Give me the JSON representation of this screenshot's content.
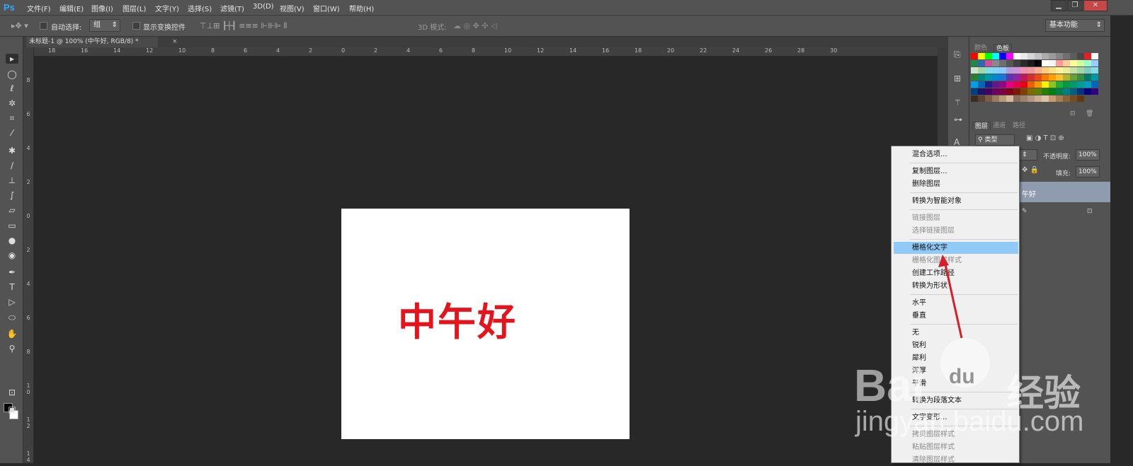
{
  "app": {
    "logo": "Ps",
    "menu": [
      "文件(F)",
      "编辑(E)",
      "图像(I)",
      "图层(L)",
      "文字(Y)",
      "选择(S)",
      "滤镜(T)",
      "3D(D)",
      "视图(V)",
      "窗口(W)",
      "帮助(H)"
    ],
    "window_buttons": [
      "▁",
      "❐",
      "✕"
    ]
  },
  "options": {
    "auto_select": "自动选择:",
    "group_value": "组",
    "show_transform": "显示变换控件",
    "mode3d": "3D 模式:",
    "workspace": "基本功能"
  },
  "document": {
    "tab_title": "未标题-1 @ 100% (中午好, RGB/8) *",
    "close": "×",
    "canvas_text": "中午好"
  },
  "rulers": {
    "h": [
      "18",
      "16",
      "14",
      "12",
      "10",
      "8",
      "6",
      "4",
      "2",
      "0",
      "2",
      "4",
      "6",
      "8",
      "10",
      "12",
      "14",
      "16",
      "18",
      "20",
      "22",
      "24",
      "26",
      "28",
      "30"
    ],
    "v": [
      "8",
      "6",
      "4",
      "2",
      "0",
      "2",
      "4",
      "6",
      "8",
      "1\n0",
      "1\n2",
      "1\n4"
    ]
  },
  "panels": {
    "color_tabs": [
      "颜色",
      "色板"
    ],
    "layers_tabs": [
      "图层",
      "通道",
      "路径"
    ],
    "kind": "类型",
    "opacity_label": "不透明度:",
    "opacity": "100%",
    "fill_label": "填充:",
    "fill": "100%",
    "layer_name": "午好"
  },
  "swatch_colors": [
    [
      "#ff0000",
      "#ffff00",
      "#00ff00",
      "#00ffff",
      "#0000ff",
      "#ff00ff",
      "#ffffff",
      "#ebebeb",
      "#d6d6d6",
      "#c2c2c2",
      "#adadad",
      "#999999",
      "#858585",
      "#707070",
      "#5c5c5c",
      "#474747",
      "#ed1c24",
      "#ffffff"
    ],
    [
      "#1e8a48",
      "#2b6bb5",
      "#d44c9a",
      "#8a8a8a",
      "#6e6e6e",
      "#555555",
      "#404040",
      "#2b2b2b",
      "#1a1a1a",
      "#000000",
      "#ffffff",
      "#f5f5f5",
      "#ff9999",
      "#ffcc99",
      "#ffff99",
      "#ccff99",
      "#99ffcc",
      "#99ccff"
    ],
    [
      "#c8e6c9",
      "#a5d6a7",
      "#80deea",
      "#81d4fa",
      "#90caf9",
      "#b39ddb",
      "#ce93d8",
      "#f48fb1",
      "#ef9a9a",
      "#ffab91",
      "#ffcc80",
      "#ffe082",
      "#fff59d",
      "#e6ee9c",
      "#c5e1a5",
      "#a5d6a7",
      "#80cbc4",
      "#80deea"
    ],
    [
      "#2e7d32",
      "#00897b",
      "#0097a7",
      "#0288d1",
      "#1976d2",
      "#5e35b1",
      "#8e24aa",
      "#c2185b",
      "#d32f2f",
      "#e64a19",
      "#f57c00",
      "#ffa000",
      "#fbc02d",
      "#afb42b",
      "#689f38",
      "#388e3c",
      "#00796b",
      "#0097a7"
    ],
    [
      "#00a0e9",
      "#0068b7",
      "#1d2088",
      "#601986",
      "#920783",
      "#e4007f",
      "#e5004f",
      "#e60012",
      "#eb6100",
      "#f39800",
      "#fff100",
      "#8fc31f",
      "#22ac38",
      "#009944",
      "#009b6b",
      "#009e96",
      "#00a0c1",
      "#0068b7"
    ],
    [
      "#003f7f",
      "#1b1464",
      "#440062",
      "#6a005f",
      "#7d0045",
      "#7f0019",
      "#7f1900",
      "#7f4100",
      "#7f6a00",
      "#5f7f00",
      "#2a7f00",
      "#007f12",
      "#007f49",
      "#007f7f",
      "#005f7f",
      "#00347f",
      "#0a007f",
      "#33007f"
    ],
    [
      "#3d2b1f",
      "#5c4033",
      "#7b5b46",
      "#9a7b5f",
      "#b89b7a",
      "#d7bb96",
      "#8b6d5c",
      "#a0826d",
      "#b5977f",
      "#cbad92",
      "#e0c3a6",
      "#c69c6d",
      "#a67c52",
      "#8c6239",
      "#754c24",
      "#603913",
      null,
      null
    ]
  ],
  "context_menu": [
    {
      "label": "混合选项...",
      "state": "normal"
    },
    {
      "sep": true
    },
    {
      "label": "复制图层...",
      "state": "normal"
    },
    {
      "label": "删除图层",
      "state": "normal"
    },
    {
      "sep": true
    },
    {
      "label": "转换为智能对象",
      "state": "normal"
    },
    {
      "sep": true
    },
    {
      "label": "链接图层",
      "state": "disabled"
    },
    {
      "label": "选择链接图层",
      "state": "disabled"
    },
    {
      "sep": true
    },
    {
      "label": "栅格化文字",
      "state": "highlighted"
    },
    {
      "label": "栅格化图层样式",
      "state": "disabled"
    },
    {
      "label": "创建工作路径",
      "state": "normal"
    },
    {
      "label": "转换为形状",
      "state": "normal"
    },
    {
      "sep": true
    },
    {
      "label": "水平",
      "state": "normal"
    },
    {
      "label": "垂直",
      "state": "normal"
    },
    {
      "sep": true
    },
    {
      "label": "无",
      "state": "normal"
    },
    {
      "label": "锐利",
      "state": "normal"
    },
    {
      "label": "犀利",
      "state": "normal"
    },
    {
      "label": "浑厚",
      "state": "normal"
    },
    {
      "label": "平滑",
      "state": "normal"
    },
    {
      "sep": true
    },
    {
      "label": "转换为段落文本",
      "state": "normal"
    },
    {
      "sep": true
    },
    {
      "label": "文字变形...",
      "state": "normal"
    },
    {
      "sep": true
    },
    {
      "label": "拷贝图层样式",
      "state": "disabled"
    },
    {
      "label": "粘贴图层样式",
      "state": "disabled"
    },
    {
      "label": "清除图层样式",
      "state": "disabled"
    }
  ],
  "watermark": {
    "brand": "Bai",
    "du": "du",
    "cn": "经验",
    "url": "jingyan.baidu.com"
  },
  "colors": {
    "text_red": "#e5141c",
    "menu_highlight": "#91c9f7",
    "arrow": "#d61f2b"
  }
}
